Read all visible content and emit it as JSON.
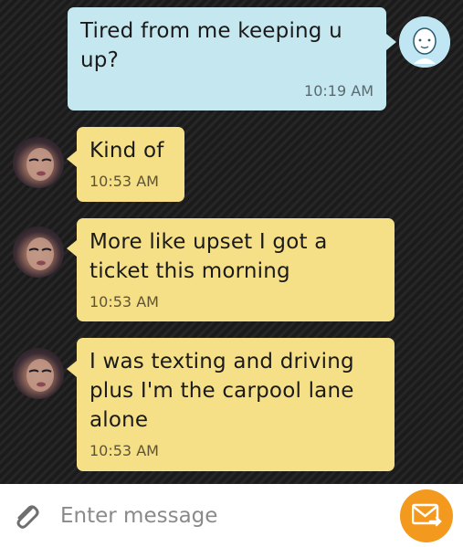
{
  "messages": [
    {
      "direction": "sent",
      "text": "Tired from me keeping u\nup?",
      "time": "10:19 AM"
    },
    {
      "direction": "received",
      "text": "Kind of",
      "time": "10:53 AM"
    },
    {
      "direction": "received",
      "text": "More like upset I got a\nticket this morning",
      "time": "10:53 AM"
    },
    {
      "direction": "received",
      "text": "I was texting and driving\nplus I'm the carpool lane\nalone",
      "time": "10:53 AM"
    }
  ],
  "composer": {
    "placeholder": "Enter message",
    "attach_icon": "paperclip-icon",
    "send_icon": "envelope-send-icon"
  },
  "colors": {
    "sent_bubble": "#c5e7f0",
    "received_bubble": "#f6e087",
    "send_button": "#f39a1e"
  }
}
